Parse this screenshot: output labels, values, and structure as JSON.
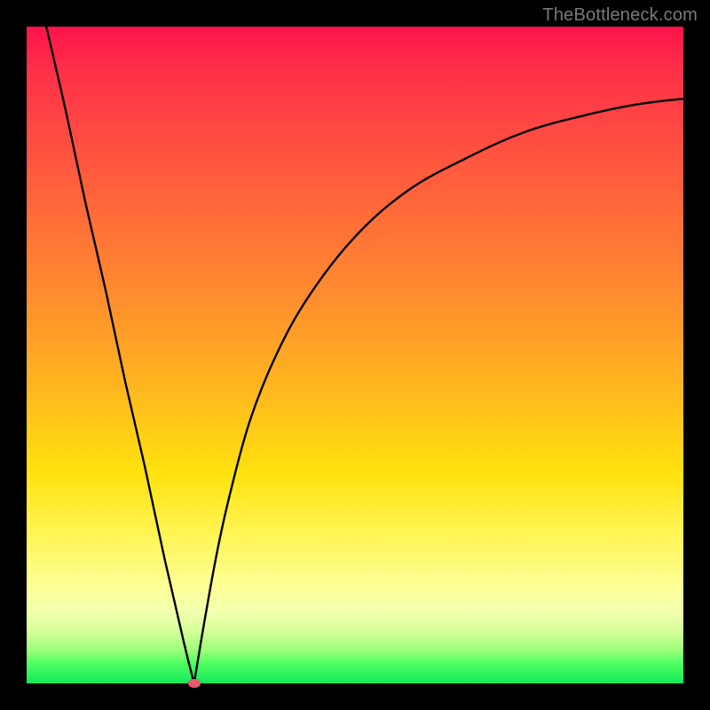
{
  "watermark": "TheBottleneck.com",
  "colors": {
    "frame": "#000000",
    "gradient_top": "#ff124a",
    "gradient_bottom": "#16e85c",
    "curve": "#000000",
    "marker": "#e85a6f",
    "watermark_text": "#7a7a7a"
  },
  "chart_data": {
    "type": "line",
    "title": "",
    "xlabel": "",
    "ylabel": "",
    "xlim": [
      0,
      100
    ],
    "ylim": [
      0,
      100
    ],
    "grid": false,
    "legend": false,
    "series": [
      {
        "name": "left-branch",
        "x": [
          3,
          6,
          9,
          12,
          15,
          18,
          21,
          24,
          25.5
        ],
        "values": [
          100,
          87,
          73,
          60,
          46,
          33,
          19,
          6,
          0
        ]
      },
      {
        "name": "right-branch",
        "x": [
          25.5,
          27,
          29,
          31,
          34,
          38,
          43,
          50,
          58,
          67,
          76,
          85,
          92,
          97,
          100
        ],
        "values": [
          0,
          9,
          20,
          29,
          40,
          50,
          59,
          68,
          75,
          80,
          84,
          86.5,
          88,
          88.7,
          89
        ]
      }
    ],
    "annotations": [
      {
        "name": "minimum-marker",
        "x": 25.5,
        "y": 0
      }
    ]
  }
}
